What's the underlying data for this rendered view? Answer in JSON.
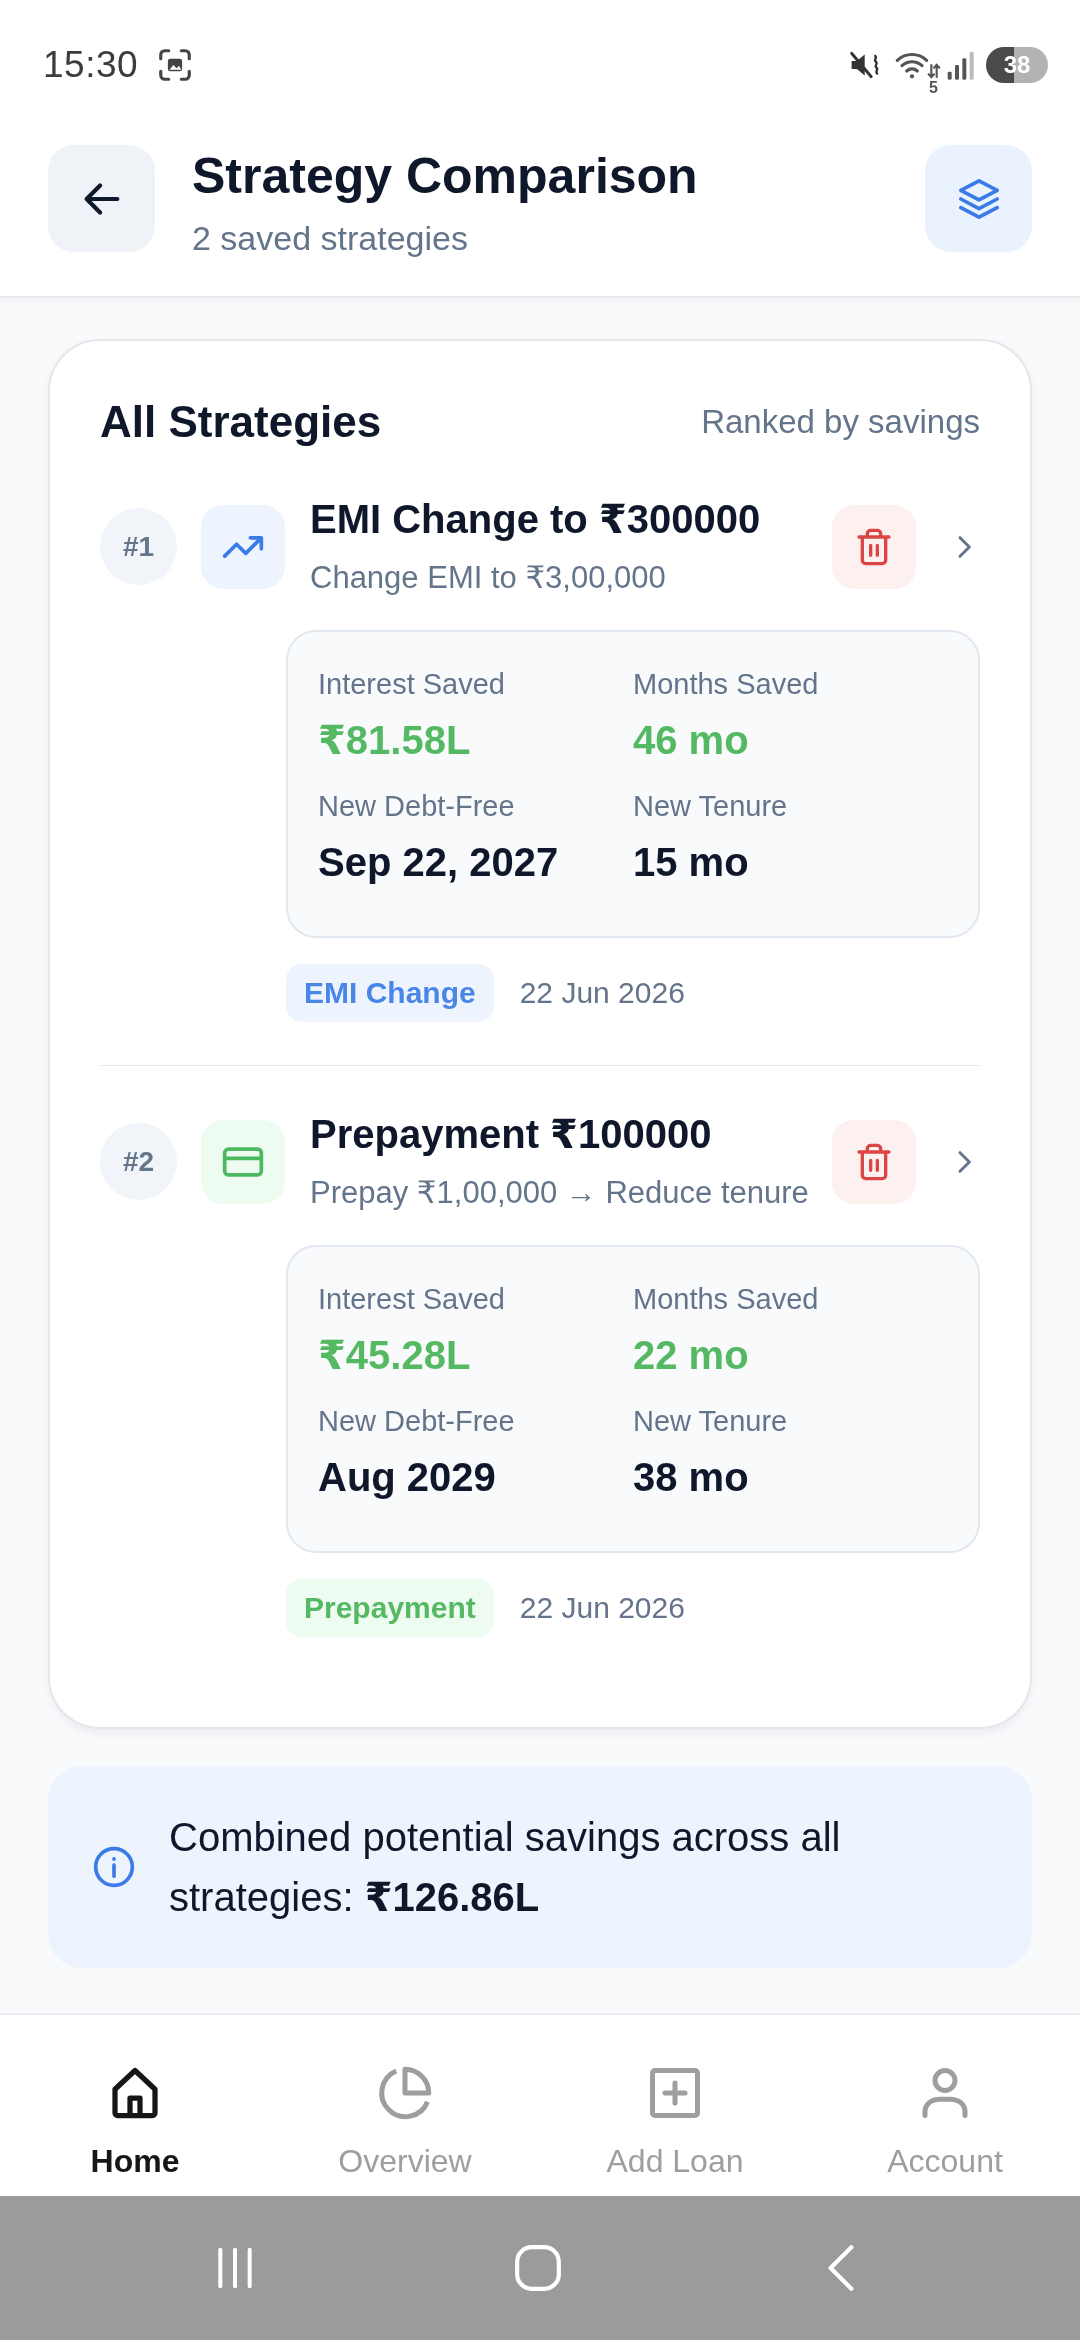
{
  "status_bar": {
    "time": "15:30",
    "network": "5",
    "battery": "38"
  },
  "header": {
    "title": "Strategy Comparison",
    "subtitle": "2 saved strategies"
  },
  "strategies": {
    "title": "All Strategies",
    "sort_note": "Ranked by savings",
    "items": [
      {
        "rank": "#1",
        "kind": "emi_change",
        "title": "EMI Change to ₹300000",
        "description": "Change EMI to ₹3,00,000",
        "stats": [
          {
            "label": "Interest Saved",
            "value": "₹81.58L",
            "kind": "saving"
          },
          {
            "label": "Months Saved",
            "value": "46 mo",
            "kind": "saving"
          },
          {
            "label": "New Debt-Free",
            "value": "Sep 22, 2027",
            "kind": "plain"
          },
          {
            "label": "New Tenure",
            "value": "15 mo",
            "kind": "plain"
          }
        ],
        "tag": "EMI Change",
        "date": "22 Jun 2026"
      },
      {
        "rank": "#2",
        "kind": "prepayment",
        "title": "Prepayment ₹100000",
        "description": "Prepay ₹1,00,000 → Reduce tenure",
        "stats": [
          {
            "label": "Interest Saved",
            "value": "₹45.28L",
            "kind": "saving"
          },
          {
            "label": "Months Saved",
            "value": "22 mo",
            "kind": "saving"
          },
          {
            "label": "New Debt-Free",
            "value": "Aug 2029",
            "kind": "plain"
          },
          {
            "label": "New Tenure",
            "value": "38 mo",
            "kind": "plain"
          }
        ],
        "tag": "Prepayment",
        "date": "22 Jun 2026"
      }
    ]
  },
  "summary": {
    "text": "Combined potential savings across all strategies: **₹126.86L**"
  },
  "bottom_nav": [
    {
      "label": "Home",
      "selected": true
    },
    {
      "label": "Overview",
      "selected": false
    },
    {
      "label": "Add Loan",
      "selected": false
    },
    {
      "label": "Account",
      "selected": false
    }
  ]
}
